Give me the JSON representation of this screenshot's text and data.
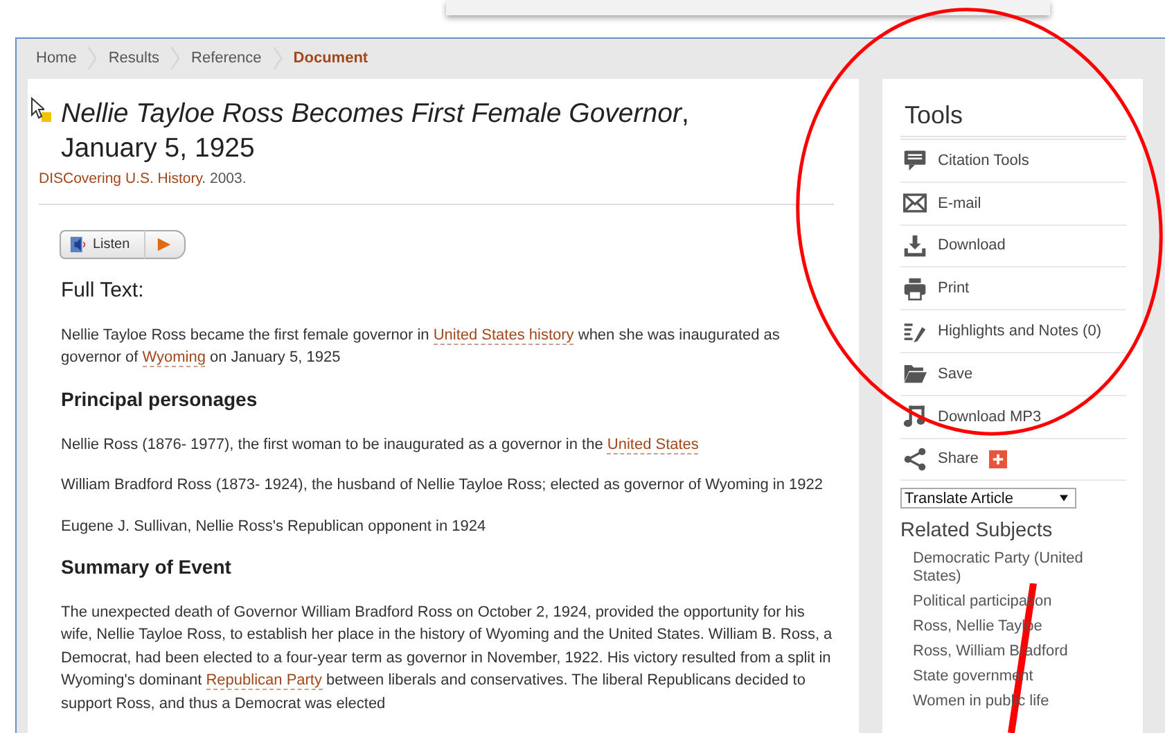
{
  "breadcrumb": [
    {
      "label": "Home",
      "selected": false
    },
    {
      "label": "Results",
      "selected": false
    },
    {
      "label": "Reference",
      "selected": false
    },
    {
      "label": "Document",
      "selected": true
    }
  ],
  "article": {
    "title": "*Nellie Tayloe Ross Becomes First Female Governor*, January 5, 1925",
    "source": [
      {
        "text": "DISCovering U.S. History",
        "link": true
      },
      {
        "text": ". 2003.",
        "link": false
      }
    ],
    "listen_label": "Listen",
    "sections": [
      {
        "kind": "subhead",
        "parts": [
          {
            "text": "Full Text:",
            "link": false
          }
        ]
      },
      {
        "kind": "para",
        "parts": [
          {
            "text": "Nellie Tayloe Ross became the first female governor in ",
            "link": false
          },
          {
            "text": "United States history",
            "link": true
          },
          {
            "text": " when she was inaugurated as governor of ",
            "link": false
          },
          {
            "text": "Wyoming",
            "link": true
          },
          {
            "text": " on January 5, 1925",
            "link": false
          }
        ]
      },
      {
        "kind": "heading",
        "parts": [
          {
            "text": "Principal personages",
            "link": false
          }
        ]
      },
      {
        "kind": "para",
        "parts": [
          {
            "text": "Nellie Ross (1876- 1977), the first woman to be inaugurated as a governor in the ",
            "link": false
          },
          {
            "text": "United States",
            "link": true
          }
        ]
      },
      {
        "kind": "para",
        "parts": [
          {
            "text": "William Bradford Ross (1873- 1924), the husband of Nellie Tayloe Ross; elected as governor of Wyoming in 1922",
            "link": false
          }
        ]
      },
      {
        "kind": "para",
        "parts": [
          {
            "text": "Eugene J. Sullivan, Nellie Ross's Republican opponent in 1924",
            "link": false
          }
        ]
      },
      {
        "kind": "heading",
        "parts": [
          {
            "text": "Summary of Event",
            "link": false
          }
        ]
      },
      {
        "kind": "para",
        "parts": [
          {
            "text": "The unexpected death of Governor William Bradford Ross on October 2, 1924, provided the opportunity for his wife, Nellie Tayloe Ross, to establish her place in the history of Wyoming and the United States. William B. Ross, a Democrat, had been elected to a four-year term as governor in November, 1922. His victory resulted from a split in Wyoming's dominant ",
            "link": false
          },
          {
            "text": "Republican Party",
            "link": true
          },
          {
            "text": " between liberals and conservatives. The liberal Republicans decided to support Ross, and thus a Democrat was elected",
            "link": false
          }
        ]
      }
    ]
  },
  "tools": {
    "title": "Tools",
    "items": [
      {
        "kind": "citation",
        "label": "Citation Tools"
      },
      {
        "kind": "email",
        "label": "E-mail"
      },
      {
        "kind": "download",
        "label": "Download"
      },
      {
        "kind": "print",
        "label": "Print"
      },
      {
        "kind": "notes",
        "label": "Highlights and Notes (0)"
      },
      {
        "kind": "folder",
        "label": "Save"
      },
      {
        "kind": "music",
        "label": "Download MP3"
      },
      {
        "kind": "share",
        "label": "Share"
      }
    ],
    "translate": "Translate Article"
  },
  "related": {
    "title": "Related Subjects",
    "items": [
      "Democratic Party (United States)",
      "Political participation",
      "Ross, Nellie Tayloe",
      "Ross, William Bradford",
      "State government",
      "Women in public life"
    ]
  }
}
